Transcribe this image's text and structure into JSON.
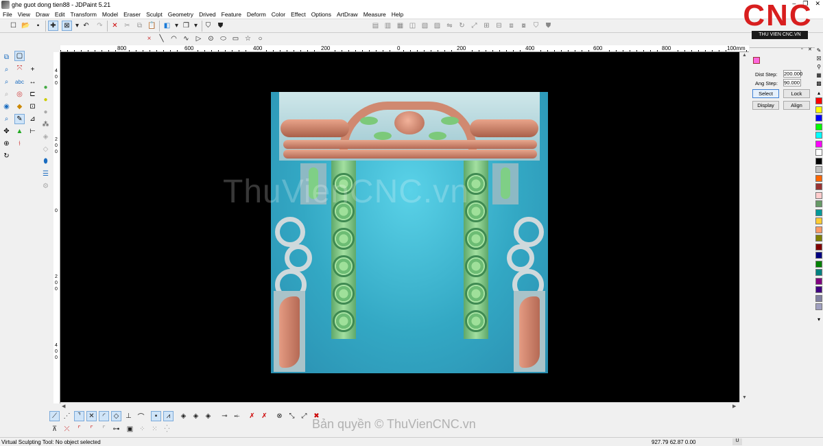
{
  "window": {
    "title": "ghe guot dong tien88 - JDPaint 5.21",
    "controls": [
      "–",
      "❐",
      "✕"
    ]
  },
  "menu": [
    "File",
    "View",
    "Draw",
    "Edit",
    "Transform",
    "Model",
    "Eraser",
    "Sculpt",
    "Geometry",
    "Drived",
    "Feature",
    "Deform",
    "Color",
    "Effect",
    "Options",
    "ArtDraw",
    "Measure",
    "Help"
  ],
  "ruler": {
    "labels": [
      "800",
      "600",
      "400",
      "200",
      "0",
      "200",
      "400",
      "600",
      "800",
      "100mm"
    ],
    "vertical": [
      "4",
      "0",
      "0",
      "2",
      "0",
      "0",
      "0",
      "2",
      "0",
      "0",
      "4",
      "0",
      "0"
    ]
  },
  "canvas": {
    "watermark": "ThuVienCNC.vn",
    "background": "#000000"
  },
  "panel": {
    "dist_step_label": "Dist Step:",
    "dist_step_value": "200.000",
    "ang_step_label": "Ang Step:",
    "ang_step_value": "90.000",
    "buttons": [
      "Select",
      "Lock",
      "Display",
      "Align"
    ],
    "controls": [
      "▫",
      "✕"
    ]
  },
  "palette": [
    "#ff0000",
    "#ffff00",
    "#0000ff",
    "#00ff00",
    "#00ffff",
    "#ff00ff",
    "#ffffff",
    "#000000",
    "#c0c0c0",
    "#ff6600",
    "#993333",
    "#ffcccc",
    "#669966",
    "#009999",
    "#ffcc33",
    "#ff9966",
    "#808000",
    "#800000",
    "#000080",
    "#008000",
    "#008080",
    "#800080",
    "#400080",
    "#8080a0",
    "#a0a0c0"
  ],
  "status": {
    "message": "Virtual Sculpting Tool: No object selected",
    "coords": "927.79 62.87 0.00",
    "mode": "U"
  },
  "logo": {
    "text": "CNC",
    "subtitle": "THU VIEN CNC.VN"
  },
  "copyright": "Bản quyền © ThuVienCNC.vn",
  "icons": {
    "toolbar_main": [
      "new-file-icon",
      "open-icon",
      "save-icon",
      "crosshair-icon",
      "select-box-icon",
      "undo-icon",
      "redo-icon",
      "delete-icon",
      "cut-icon",
      "copy-icon",
      "paste-icon"
    ],
    "draw": [
      "point-icon",
      "line-icon",
      "arc-icon",
      "curve-icon",
      "polygon-icon",
      "circle-icon",
      "ellipse-icon",
      "rectangle-icon",
      "star-icon",
      "circle-outline-icon"
    ]
  }
}
